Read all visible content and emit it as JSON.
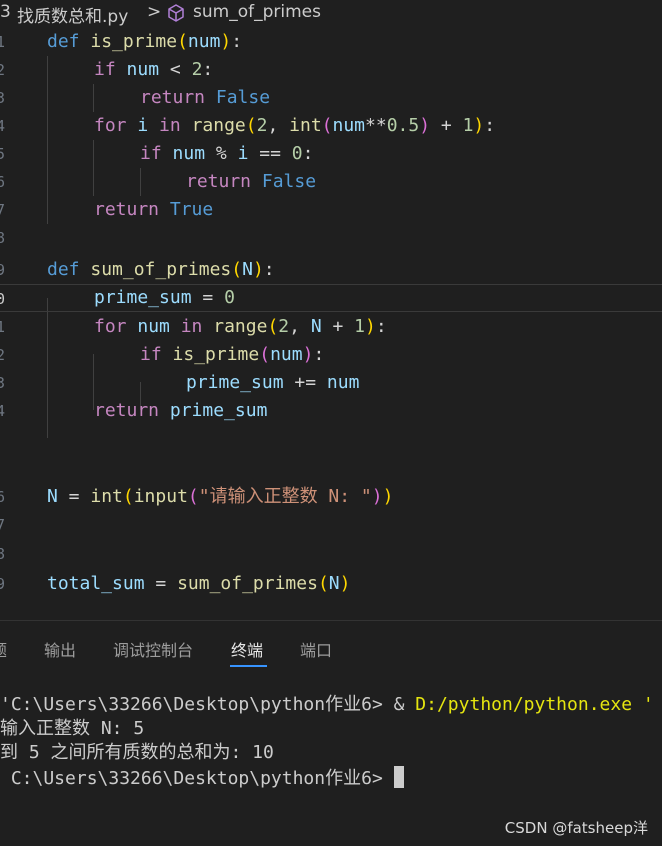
{
  "breadcrumb": {
    "folder_num": "3",
    "file": "找质数总和.py",
    "chevron": ">",
    "symbol": "sum_of_primes",
    "symbol_icon": "cube-icon"
  },
  "gutter": [
    "1",
    "2",
    "3",
    "4",
    "5",
    "6",
    "7",
    "8",
    "9",
    "0",
    "1",
    "2",
    "3",
    "4",
    "",
    "6",
    "7",
    "8",
    "9",
    "0"
  ],
  "code": {
    "l1": {
      "kw": "def",
      "fn": "is_prime",
      "p_open": "(",
      "arg": "num",
      "p_close": ")",
      "colon": ":"
    },
    "l2": {
      "kw": "if",
      "var": "num",
      "op": " < ",
      "num": "2",
      "colon": ":"
    },
    "l3": {
      "kw": "return",
      "val": "False"
    },
    "l4": {
      "kw": "for",
      "var": "i",
      "kw2": "in",
      "fn": "range",
      "p1o": "(",
      "n1": "2",
      "comma": ", ",
      "fn2": "int",
      "p2o": "(",
      "var2": "num",
      "op": "**",
      "n2": "0.5",
      "p2c": ")",
      "op2": " + ",
      "n3": "1",
      "p1c": ")",
      "colon": ":"
    },
    "l5": {
      "kw": "if",
      "var": "num",
      "op": " % ",
      "var2": "i",
      "op2": " == ",
      "num": "0",
      "colon": ":"
    },
    "l6": {
      "kw": "return",
      "val": "False"
    },
    "l7": {
      "kw": "return",
      "val": "True"
    },
    "l9": {
      "kw": "def",
      "fn": "sum_of_primes",
      "p_open": "(",
      "arg": "N",
      "p_close": ")",
      "colon": ":"
    },
    "l10": {
      "var": "prime_sum",
      "op": " = ",
      "num": "0"
    },
    "l11": {
      "kw": "for",
      "var": "num",
      "kw2": "in",
      "fn": "range",
      "p1o": "(",
      "n1": "2",
      "comma": ", ",
      "var2": "N",
      "op": " + ",
      "n2": "1",
      "p1c": ")",
      "colon": ":"
    },
    "l12": {
      "kw": "if",
      "fn": "is_prime",
      "p_open": "(",
      "arg": "num",
      "p_close": ")",
      "colon": ":"
    },
    "l13": {
      "var": "prime_sum",
      "op": " += ",
      "var2": "num"
    },
    "l14": {
      "kw": "return",
      "var": "prime_sum"
    },
    "l17": {
      "var": "N",
      "op": " = ",
      "fn": "int",
      "p1o": "(",
      "fn2": "input",
      "p2o": "(",
      "str": "\"请输入正整数 N: \"",
      "p2c": ")",
      "p1c": ")"
    },
    "l20": {
      "var": "total_sum",
      "op": " = ",
      "fn": "sum_of_primes",
      "p_open": "(",
      "arg": "N",
      "p_close": ")"
    }
  },
  "panel": {
    "tabs": [
      "题",
      "输出",
      "调试控制台",
      "终端",
      "端口"
    ],
    "active_tab": "终端"
  },
  "terminal": {
    "line1_prefix": "'C:\\Users\\33266\\Desktop\\python作业6> & ",
    "line1_cmd": "D:/python/python.exe '",
    "line2": "输入正整数 N: 5",
    "line3": "到 5 之间所有质数的总和为: 10",
    "line4": " C:\\Users\\33266\\Desktop\\python作业6> "
  },
  "watermark": "CSDN @fatsheep洋"
}
